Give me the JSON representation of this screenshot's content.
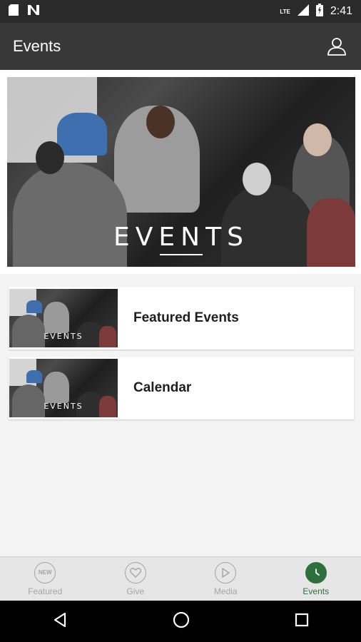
{
  "status_bar": {
    "network": "LTE",
    "time": "2:41"
  },
  "app_bar": {
    "title": "Events",
    "account_icon": "account-icon"
  },
  "hero": {
    "title": "EVENTS"
  },
  "list": {
    "items": [
      {
        "label": "Featured Events",
        "thumb_label": "EVENTS"
      },
      {
        "label": "Calendar",
        "thumb_label": "EVENTS"
      }
    ]
  },
  "bottom_nav": {
    "items": [
      {
        "label": "Featured",
        "icon": "new-icon",
        "icon_text": "NEW",
        "active": false
      },
      {
        "label": "Give",
        "icon": "heart-icon",
        "active": false
      },
      {
        "label": "Media",
        "icon": "play-icon",
        "active": false
      },
      {
        "label": "Events",
        "icon": "clock-icon",
        "active": true
      }
    ]
  },
  "colors": {
    "status_bar": "#2a2a2a",
    "app_bar": "#383838",
    "accent": "#2e6f3e",
    "background": "#f4f4f4"
  }
}
